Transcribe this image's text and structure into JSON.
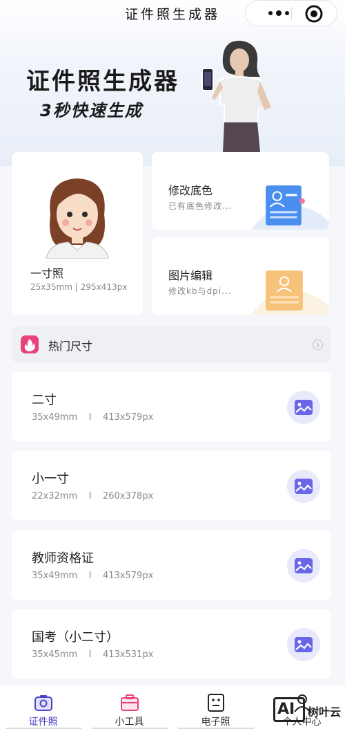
{
  "header": {
    "title": "证件照生成器"
  },
  "hero": {
    "title": "证件照生成器",
    "subtitle": "3秒快速生成"
  },
  "features": {
    "one_inch": {
      "title": "一寸照",
      "desc": "25x35mm | 295x413px"
    },
    "change_bg": {
      "title": "修改底色",
      "desc": "已有底色修改..."
    },
    "edit_image": {
      "title": "图片编辑",
      "desc": "修改kb与dpi..."
    }
  },
  "hot": {
    "label": "热门尺寸"
  },
  "sizes": [
    {
      "name": "二寸",
      "spec": "35x49mm    I    413x579px"
    },
    {
      "name": "小一寸",
      "spec": "22x32mm    I    260x378px"
    },
    {
      "name": "教师资格证",
      "spec": "35x49mm    I    413x579px"
    },
    {
      "name": "国考（小二寸）",
      "spec": "35x45mm    I    413x531px"
    }
  ],
  "tabs": [
    {
      "label": "证件照",
      "icon": "camera-icon"
    },
    {
      "label": "小工具",
      "icon": "toolbox-icon"
    },
    {
      "label": "电子照",
      "icon": "id-card-icon"
    },
    {
      "label": "个人中心",
      "icon": "user-icon"
    }
  ],
  "watermark": {
    "logo": "AI",
    "text": "树叶云"
  },
  "colors": {
    "accent": "#4b44c8",
    "fire": "#e9417a",
    "picture_icon": "#6a66e8"
  }
}
